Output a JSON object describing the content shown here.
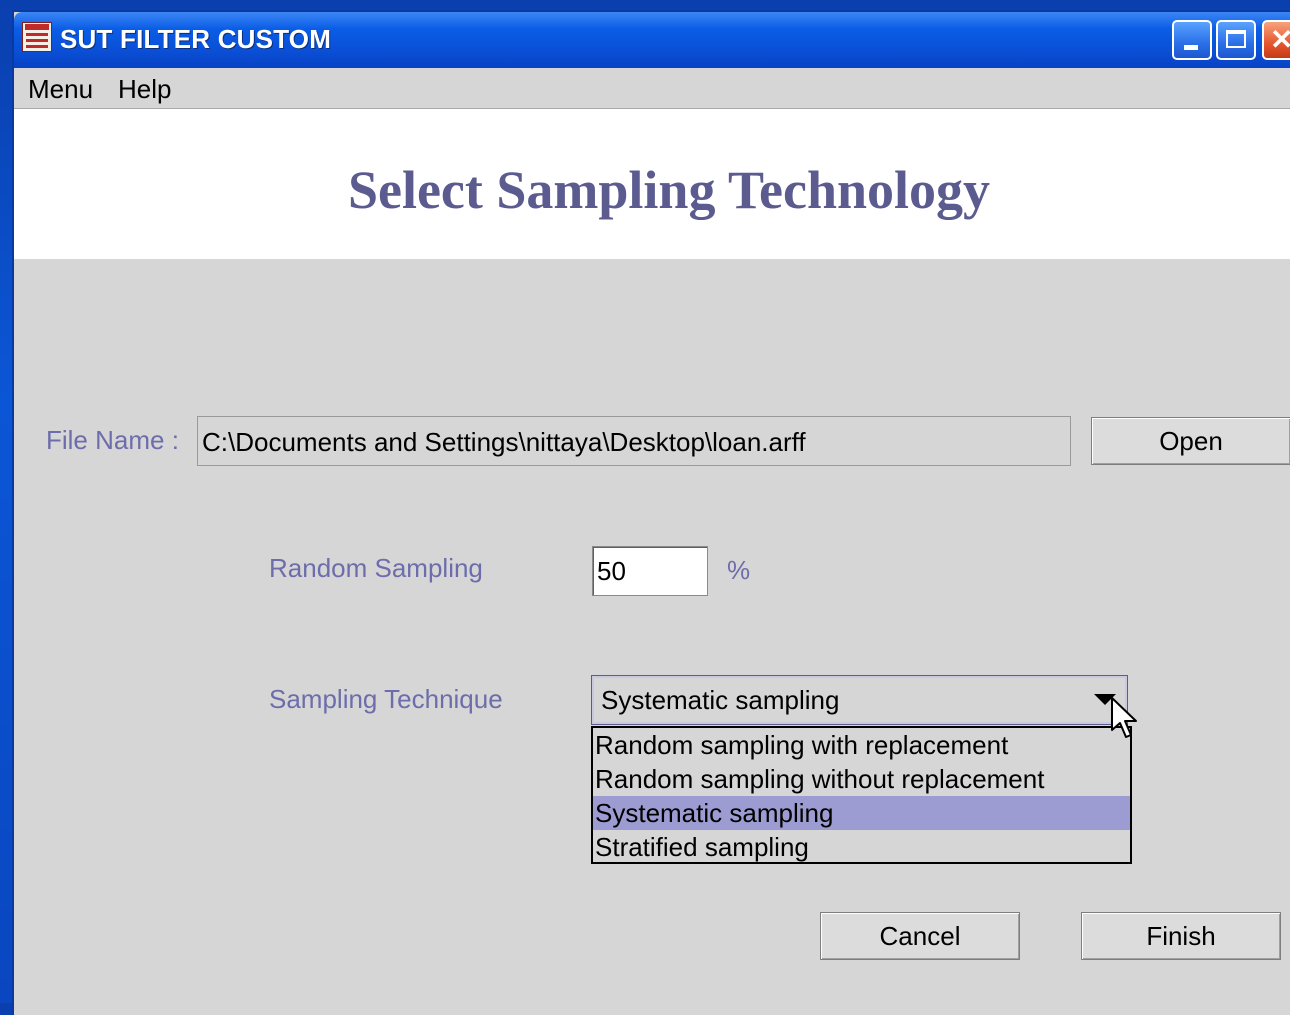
{
  "window": {
    "title": "SUT FILTER CUSTOM"
  },
  "menubar": {
    "items": [
      {
        "label": "Menu"
      },
      {
        "label": "Help"
      }
    ]
  },
  "header": {
    "title": "Select Sampling Technology"
  },
  "form": {
    "file_name": {
      "label": "File Name :",
      "value": "C:\\Documents and Settings\\nittaya\\Desktop\\loan.arff",
      "open_label": "Open"
    },
    "random_sampling": {
      "label": "Random Sampling",
      "value": "50",
      "unit": "%"
    },
    "sampling_technique": {
      "label": "Sampling Technique",
      "selected": "Systematic sampling",
      "options": [
        {
          "label": "Random sampling with replacement"
        },
        {
          "label": "Random sampling without replacement"
        },
        {
          "label": "Systematic sampling"
        },
        {
          "label": "Stratified sampling"
        }
      ],
      "selected_index": 2
    },
    "buttons": {
      "cancel_label": "Cancel",
      "finish_label": "Finish"
    }
  },
  "colors": {
    "accent_label": "#6d6dab",
    "title_text": "#5b5b8f",
    "selection": "#9c9cd2",
    "titlebar": "#0b5de6"
  },
  "icons": {
    "app": "java-cup-icon",
    "minimize": "minimize-icon",
    "maximize": "maximize-icon",
    "close": "close-icon",
    "dropdown": "triangle-down-icon",
    "cursor": "mouse-pointer-icon"
  }
}
